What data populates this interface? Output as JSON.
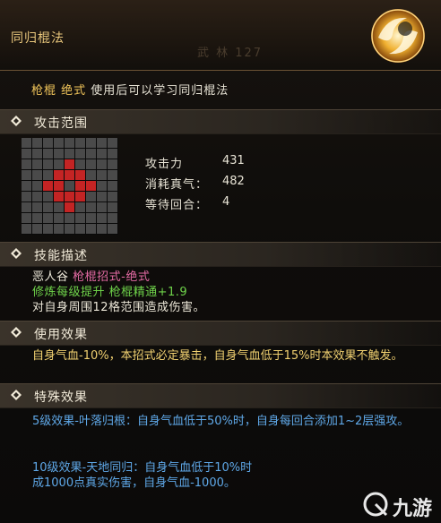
{
  "header": {
    "title": "同归棍法",
    "bg_text": "武  林    127",
    "icon": "spinning-staff-skill-icon"
  },
  "subtitle": {
    "type": "枪棍 绝式",
    "text": "使用后可以学习同归棍法"
  },
  "sections": {
    "range": "攻击范围",
    "description": "技能描述",
    "effect": "使用效果",
    "special": "特殊效果"
  },
  "range_grid": {
    "size": 9,
    "red_cells": [
      [
        3,
        4
      ],
      [
        4,
        3
      ],
      [
        4,
        5
      ],
      [
        5,
        4
      ],
      [
        4,
        2
      ],
      [
        4,
        6
      ],
      [
        2,
        4
      ],
      [
        6,
        4
      ],
      [
        3,
        3
      ],
      [
        3,
        5
      ],
      [
        5,
        3
      ],
      [
        5,
        5
      ]
    ]
  },
  "stats": [
    {
      "key": "攻击力",
      "sep": "：",
      "value": "431"
    },
    {
      "key": "消耗真气",
      "sep": "：",
      "value": "482"
    },
    {
      "key": "等待回合",
      "sep": "：",
      "value": "4"
    }
  ],
  "description": {
    "line1_prefix": "恶人谷",
    "line1_rest": "枪棍招式-绝式",
    "line2": "修炼每级提升 枪棍精通+1.9",
    "line3": "对自身周围12格范围造成伤害。"
  },
  "effect": {
    "text": "自身气血-10%，本招式必定暴击，自身气血低于15%时本效果不触发。"
  },
  "special": {
    "line1": "5级效果-叶落归根：自身气血低于50%时，自身每回合添加1~2层强攻。",
    "line2": "10级效果-天地同归：自身气血低于10%时",
    "line3": "成1000点真实伤害，自身气血-1000。"
  },
  "watermark": {
    "text": "九游"
  },
  "colors": {
    "title": "#e9c77c",
    "red_cell": "#c42424",
    "pink": "#e36aa3",
    "green": "#6fd34a",
    "yellow": "#f0d070",
    "blue": "#5fa8e8"
  }
}
